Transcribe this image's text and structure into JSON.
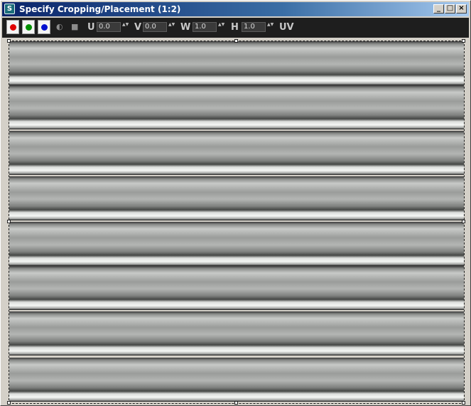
{
  "window": {
    "title": "Specify Cropping/Placement (1:2)",
    "controls": {
      "minimize": "_",
      "maximize": "□",
      "close": "×"
    }
  },
  "toolbar": {
    "channels": [
      {
        "name": "red",
        "color": "#e00000"
      },
      {
        "name": "green",
        "color": "#009000"
      },
      {
        "name": "blue",
        "color": "#0010d0"
      }
    ],
    "icons": {
      "alpha_toggle": "◐",
      "mono": "■"
    },
    "fields": {
      "u": {
        "label": "U",
        "value": "0.0"
      },
      "v": {
        "label": "V",
        "value": "0.0"
      },
      "w": {
        "label": "W",
        "value": "1.0"
      },
      "h": {
        "label": "H",
        "value": "1.0"
      }
    },
    "spinner_glyph": "▲▼",
    "uv_label": "UV"
  },
  "canvas": {
    "content": "corrugated-metal-texture"
  }
}
